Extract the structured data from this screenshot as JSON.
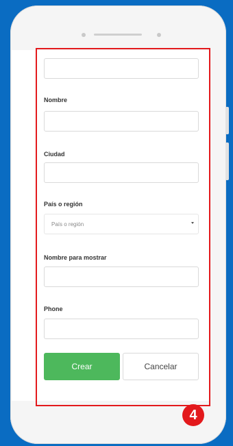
{
  "form": {
    "nombre_label": "Nombre",
    "ciudad_label": "Ciudad",
    "pais_label": "País o región",
    "pais_placeholder": "País o región",
    "nombre_mostrar_label": "Nombre para mostrar",
    "phone_label": "Phone",
    "create_label": "Crear",
    "cancel_label": "Cancelar"
  },
  "annotation": {
    "step_number": "4",
    "highlight_color": "#e3191c"
  },
  "colors": {
    "background": "#0a6cc2",
    "create_button": "#4db85c"
  }
}
